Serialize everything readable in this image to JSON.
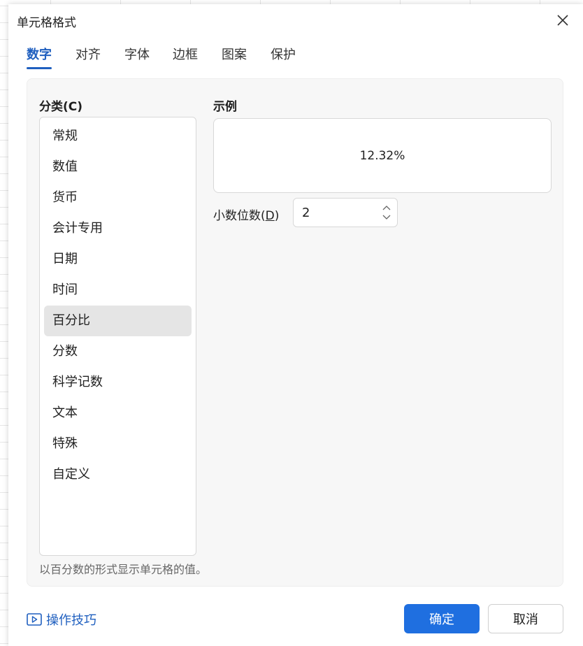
{
  "dialog": {
    "title": "单元格格式"
  },
  "tabs": [
    {
      "label": "数字",
      "active": true
    },
    {
      "label": "对齐",
      "active": false
    },
    {
      "label": "字体",
      "active": false
    },
    {
      "label": "边框",
      "active": false
    },
    {
      "label": "图案",
      "active": false
    },
    {
      "label": "保护",
      "active": false
    }
  ],
  "category": {
    "label": "分类(C)",
    "items": [
      "常规",
      "数值",
      "货币",
      "会计专用",
      "日期",
      "时间",
      "百分比",
      "分数",
      "科学记数",
      "文本",
      "特殊",
      "自定义"
    ],
    "selected": "百分比",
    "description": "以百分数的形式显示单元格的值。"
  },
  "sample": {
    "label": "示例",
    "value": "12.32%"
  },
  "decimal": {
    "label_prefix": "小数位数(",
    "label_key": "D",
    "label_suffix": ")",
    "value": "2"
  },
  "footer": {
    "tips_label": "操作技巧",
    "ok_label": "确定",
    "cancel_label": "取消"
  },
  "colors": {
    "accent": "#1f5fbf",
    "primary_button": "#1f6fe0",
    "selected_item": "#e5e5e5"
  },
  "icons": {
    "close": "close-icon",
    "tips": "play-square-icon",
    "spin_up": "chevron-up-icon",
    "spin_down": "chevron-down-icon"
  }
}
